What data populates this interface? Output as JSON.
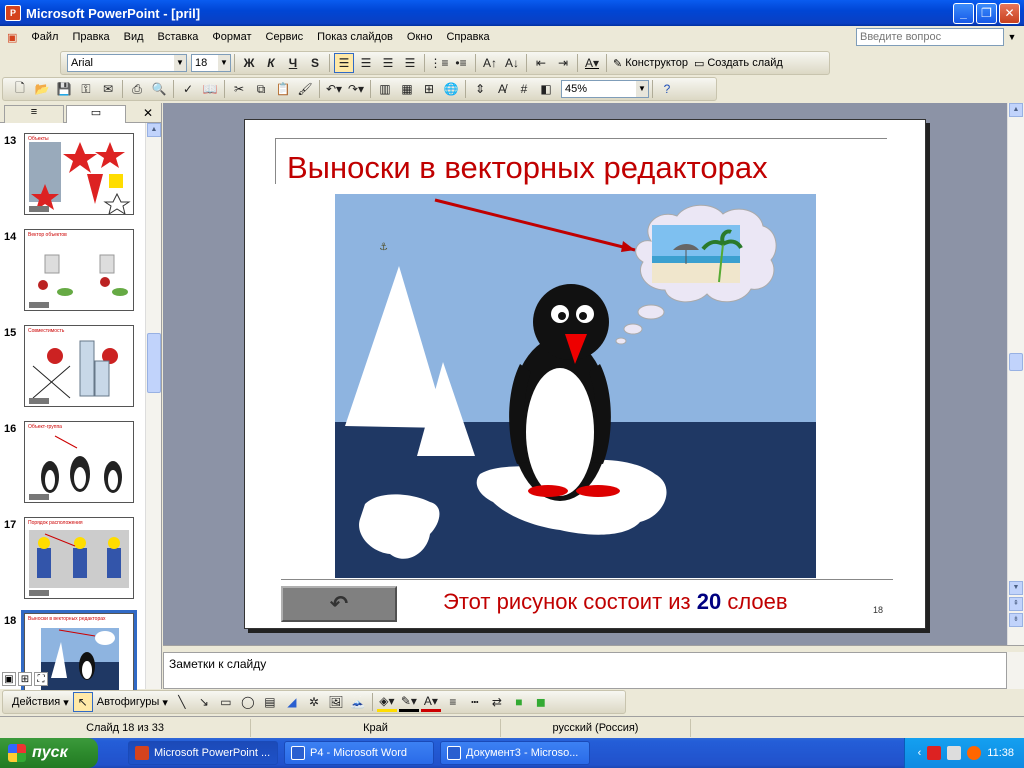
{
  "window": {
    "title": "Microsoft PowerPoint - [pril]",
    "icon_letter": "P"
  },
  "menu": [
    "Файл",
    "Правка",
    "Вид",
    "Вставка",
    "Формат",
    "Сервис",
    "Показ слайдов",
    "Окно",
    "Справка"
  ],
  "ask_placeholder": "Введите вопрос",
  "format_toolbar": {
    "font": "Arial",
    "size": "18",
    "bold": "Ж",
    "italic": "К",
    "underline": "Ч",
    "shadow": "S",
    "designer": "Конструктор",
    "new_slide": "Создать слайд"
  },
  "standard_toolbar": {
    "zoom": "45%"
  },
  "thumbnails": [
    {
      "num": "13",
      "title": "Объекты"
    },
    {
      "num": "14",
      "title": "Вектор объектов"
    },
    {
      "num": "15",
      "title": "Совместимость"
    },
    {
      "num": "16",
      "title": "Объект-группа"
    },
    {
      "num": "17",
      "title": "Порядок расположения"
    },
    {
      "num": "18",
      "title": "Выноски в векторных редакторах"
    }
  ],
  "slide": {
    "title": "Выноски в векторных редакторах",
    "caption_prefix": "Этот рисунок состоит из ",
    "caption_number": "20",
    "caption_suffix": " слоев",
    "slide_number": "18",
    "back_arrow": "↶"
  },
  "notes_label": "Заметки к слайду",
  "draw_toolbar": {
    "actions": "Действия",
    "autoshapes": "Автофигуры"
  },
  "status": {
    "slide": "Слайд 18 из 33",
    "design": "Край",
    "language": "русский (Россия)"
  },
  "taskbar": {
    "start": "пуск",
    "tasks": [
      "Microsoft PowerPoint ...",
      "P4 - Microsoft Word",
      "Документ3 - Microso..."
    ],
    "clock": "11:38"
  },
  "colors": {
    "title_red": "#c00000",
    "sky": "#8eb4e0",
    "sea": "#1f3864",
    "selection": "#316ac5"
  }
}
